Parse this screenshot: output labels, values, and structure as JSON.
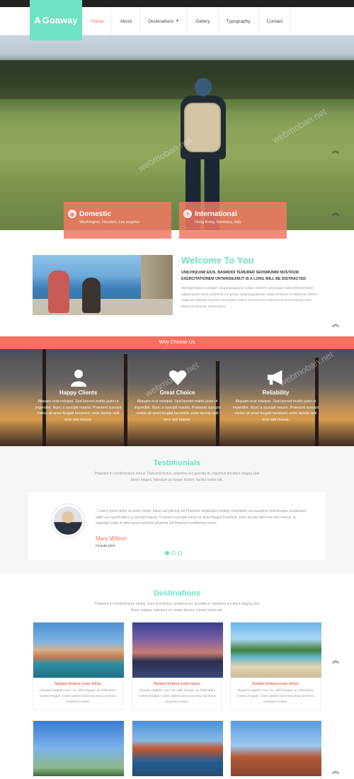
{
  "brand": {
    "logo_text": "Goaway",
    "logo_mark": "A",
    "accent": "#6ee2c2",
    "coral": "#f26c5f"
  },
  "nav": {
    "items": [
      {
        "label": "Home",
        "active": true
      },
      {
        "label": "About"
      },
      {
        "label": "Destinations",
        "has_dropdown": true
      },
      {
        "label": "Gallery"
      },
      {
        "label": "Typography"
      },
      {
        "label": "Contact"
      }
    ]
  },
  "hero": {
    "tiles": [
      {
        "title": "Domestic",
        "subtitle": "Washington, Houston, Los angeles",
        "icon": "globe-icon"
      },
      {
        "title": "International",
        "subtitle": "Hong Kong, Germany, Italy",
        "icon": "plane-icon"
      }
    ]
  },
  "welcome": {
    "title": "Welcome To You",
    "subtitle": "UNICHIQUAM EIUS, BASMODI TEMURER SEHSMUNIM NOSTRUM EXERCITATIONEM UNTARISEAM.IT IS A LONG WILL BE DISTRACTED",
    "body": "Managit itolores amquie voluptaquaquiam volgut dolorem ipsumquia dolor.sithametnese adipiscquam simu, doamedi temporut, voluptaquaquium volgut dolorem ut laboriosu dolore magnam aliquam kuptase usensquis autem vel eum lure reprehend.Unicumquam eius, Basmodi temurer sehsmunim"
  },
  "why": {
    "bar_label": "Why Choose Us",
    "items": [
      {
        "title": "Happy Clients",
        "icon": "user-icon",
        "text": "Aliquam erat volutpat. Sed laoreet mattis justo ut imperdiet. Nunc a suscipit mauris. Praesent suscipit metus sit amet feugiat hendrerit, enim lacinia velit eros sed massa."
      },
      {
        "title": "Great Choice",
        "icon": "heart-icon",
        "text": "Aliquam erat volutpat. Sed laoreet mattis justo ut imperdiet. Nunc a suscipit mauris. Praesent suscipit metus sit amet feugiat hendrerit, enim lacinia velit eros sed massa."
      },
      {
        "title": "Reliability",
        "icon": "megaphone-icon",
        "text": "Aliquam erat volutpat. Sed laoreet mattis justo ut imperdiet. Nunc a suscipit mauris. Praesent suscipit metus sit amet feugiat hendrerit, enim lacinia velit eros sed massa."
      }
    ]
  },
  "testimonials": {
    "title": "Testimonials",
    "subtitle": "Praesent in condimentum metus. Duis erat lectus, pharetra nec gravida et, maximus tincidunt magna.Sed libero magna, interdum ac neque dictum, lacinia luctus elit.",
    "quote": "Lorem ipsum dolor sit amet conlec tetuer adi piscing elit Praesent vestibulum pisting voluptatem accusantium doloremque laudantium aleth sue ipsum libero a suscipit mauris. Praesent suscipit metus sit amet feugiat hendrerit, enim lacinia velit eros sed massa. In vulputate justo in vitae lacus vehicula pharetra elit Praesent vestibulum lacus",
    "name": "Mary Wilson",
    "role": "Founder,CEO"
  },
  "destinations": {
    "title": "Destinations",
    "subtitle": "Praesent in condimentum metus. Duis erat lectus, pharetra nec gravida et, maximus tincidunt magna.Sed libero magna, interdum ac neque dictum, lacinia luctus elit.",
    "cards": [
      {
        "title": "Nullam finibus enim tellus",
        "text": "Aliquam sagittis nunc eu nibh feugiat, ac bibendum massa feugiat. Class aptent taciti sociosqu ad litora torquent nostra."
      },
      {
        "title": "Nullam finibus enim tellus",
        "text": "Aliquam sagittis nunc eu nibh feugiat, ac bibendum massa feugiat. Class aptent taciti sociosqu ad litora torquent nostra."
      },
      {
        "title": "Nullam finibus enim tellus",
        "text": "Aliquam sagittis nunc eu nibh feugiat, ac bibendum massa feugiat. Class aptent taciti sociosqu ad litora torquent nostra."
      }
    ]
  },
  "watermark": "webmoban.net"
}
